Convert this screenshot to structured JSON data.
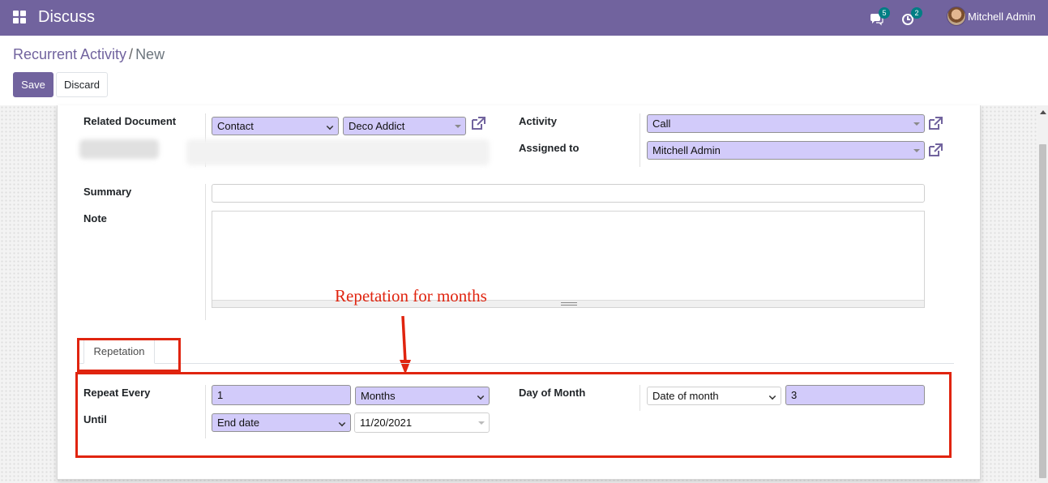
{
  "navbar": {
    "app_title": "Discuss",
    "chat_badge": "5",
    "activity_badge": "2",
    "user_name": "Mitchell Admin",
    "icons": [
      "apps-grid-icon",
      "chat-icon",
      "clock-icon",
      "avatar"
    ]
  },
  "breadcrumb": {
    "parent": "Recurrent Activity",
    "separator": "/",
    "current": "New"
  },
  "actions": {
    "save_label": "Save",
    "discard_label": "Discard"
  },
  "form": {
    "related_document": {
      "label": "Related Document",
      "model_value": "Contact",
      "record_value": "Deco Addict"
    },
    "activity": {
      "label": "Activity",
      "value": "Call"
    },
    "assigned_to": {
      "label": "Assigned to",
      "value": "Mitchell Admin"
    },
    "summary": {
      "label": "Summary",
      "value": ""
    },
    "note": {
      "label": "Note",
      "value": ""
    }
  },
  "tabs": [
    {
      "label": "Repetation",
      "active": true
    }
  ],
  "repetition": {
    "repeat_every": {
      "label": "Repeat Every",
      "interval": "1",
      "unit": "Months"
    },
    "until": {
      "label": "Until",
      "type": "End date",
      "date": "11/20/2021"
    },
    "day_of_month": {
      "label": "Day of Month",
      "mode": "Date of month",
      "day": "3"
    }
  },
  "annotation": {
    "text": "Repetation for months",
    "color": "#e0240f"
  },
  "colors": {
    "brand": "#71639e",
    "required_field": "#d2cbfa"
  }
}
